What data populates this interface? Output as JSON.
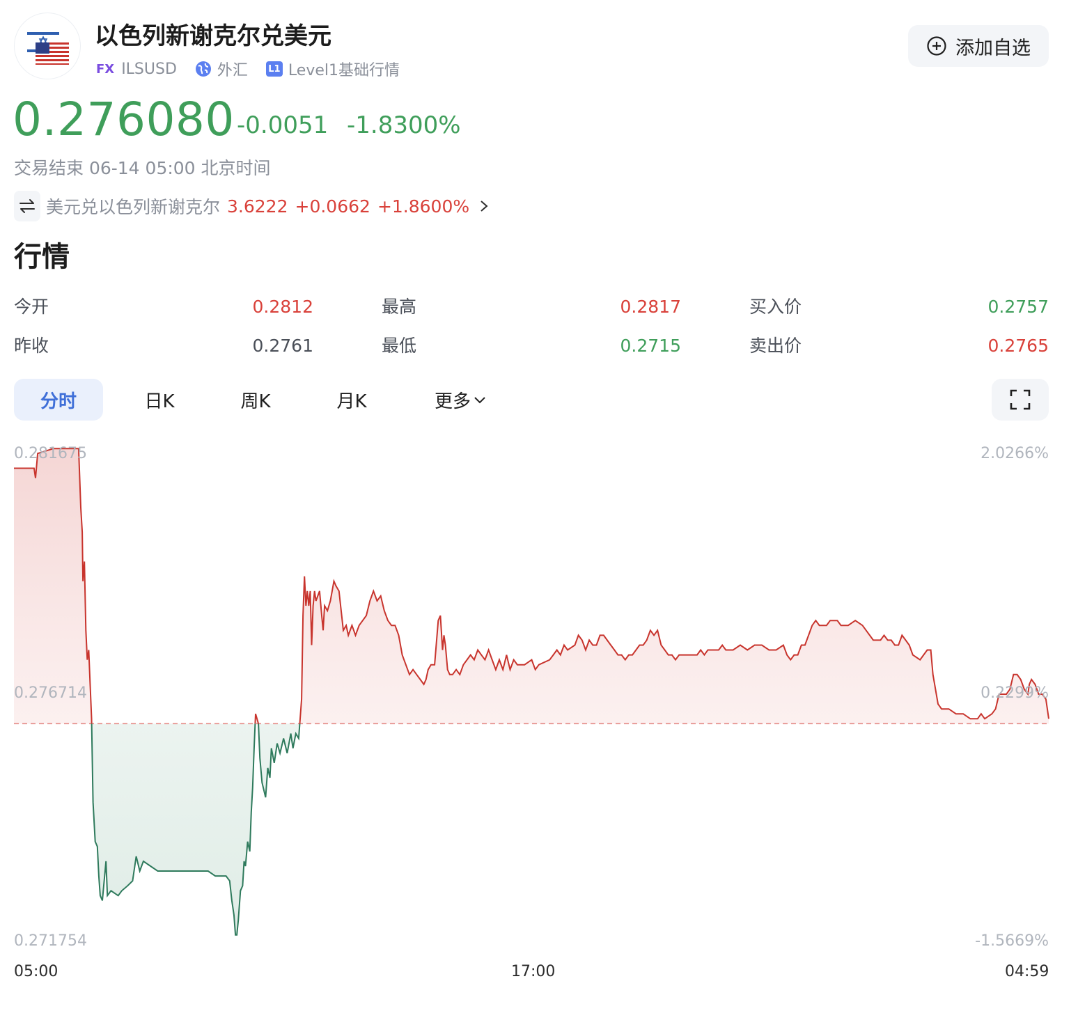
{
  "header": {
    "title": "以色列新谢克尔兑美元",
    "market_badge": "FX",
    "symbol": "ILSUSD",
    "category": "外汇",
    "level_badge": "L1",
    "level_text": "Level1基础行情",
    "add_watch_label": "添加自选"
  },
  "quote": {
    "price": "0.276080",
    "change": "-0.0051",
    "change_pct": "-1.8300%",
    "status": "交易结束 06-14 05:00 北京时间",
    "inverse_label": "美元兑以色列新谢克尔",
    "inverse_price": "3.6222",
    "inverse_change": "+0.0662",
    "inverse_change_pct": "+1.8600%"
  },
  "section_title": "行情",
  "stats": [
    {
      "label": "今开",
      "value": "0.2812",
      "color": "#d9413a"
    },
    {
      "label": "最高",
      "value": "0.2817",
      "color": "#d9413a"
    },
    {
      "label": "买入价",
      "value": "0.2757",
      "color": "#3f9e5a"
    },
    {
      "label": "昨收",
      "value": "0.2761",
      "color": "#4a4f58"
    },
    {
      "label": "最低",
      "value": "0.2715",
      "color": "#3f9e5a"
    },
    {
      "label": "卖出价",
      "value": "0.2765",
      "color": "#d9413a"
    }
  ],
  "tabs": [
    "分时",
    "日K",
    "周K",
    "月K",
    "更多"
  ],
  "colors": {
    "up": "#d9413a",
    "down": "#3f9e5a",
    "line_up": "#c8342d",
    "line_down": "#2e7a5c",
    "accent": "#3f6fd8"
  },
  "chart_data": {
    "type": "line",
    "title": "",
    "prev_close": 0.2761,
    "y_labels_left": [
      "0.281675",
      "0.276714",
      "0.271754"
    ],
    "y_labels_right": [
      "2.0266%",
      "0.2299%",
      "-1.5669%"
    ],
    "ylim": [
      0.271754,
      0.281675
    ],
    "x_labels": [
      "05:00",
      "17:00",
      "04:59"
    ],
    "x_range_minutes": [
      0,
      1439
    ],
    "points": [
      [
        0,
        0.2813
      ],
      [
        28,
        0.2813
      ],
      [
        30,
        0.2811
      ],
      [
        33,
        0.2816
      ],
      [
        55,
        0.2817
      ],
      [
        90,
        0.2817
      ],
      [
        93,
        0.2805
      ],
      [
        95,
        0.28
      ],
      [
        96,
        0.279
      ],
      [
        98,
        0.2794
      ],
      [
        100,
        0.278
      ],
      [
        102,
        0.2774
      ],
      [
        104,
        0.2776
      ],
      [
        108,
        0.2762
      ],
      [
        110,
        0.2745
      ],
      [
        113,
        0.2737
      ],
      [
        116,
        0.2736
      ],
      [
        118,
        0.273
      ],
      [
        120,
        0.2726
      ],
      [
        123,
        0.2725
      ],
      [
        128,
        0.2733
      ],
      [
        130,
        0.2726
      ],
      [
        135,
        0.2727
      ],
      [
        145,
        0.2726
      ],
      [
        150,
        0.2727
      ],
      [
        158,
        0.2728
      ],
      [
        165,
        0.2729
      ],
      [
        170,
        0.2734
      ],
      [
        175,
        0.2731
      ],
      [
        180,
        0.2733
      ],
      [
        190,
        0.2732
      ],
      [
        200,
        0.2731
      ],
      [
        210,
        0.2731
      ],
      [
        240,
        0.2731
      ],
      [
        250,
        0.2731
      ],
      [
        270,
        0.2731
      ],
      [
        280,
        0.273
      ],
      [
        295,
        0.273
      ],
      [
        300,
        0.2729
      ],
      [
        303,
        0.2725
      ],
      [
        306,
        0.2722
      ],
      [
        308,
        0.2718
      ],
      [
        310,
        0.2718
      ],
      [
        312,
        0.2721
      ],
      [
        315,
        0.2727
      ],
      [
        318,
        0.2728
      ],
      [
        320,
        0.2733
      ],
      [
        322,
        0.2732
      ],
      [
        325,
        0.2737
      ],
      [
        328,
        0.2735
      ],
      [
        330,
        0.2743
      ],
      [
        332,
        0.2748
      ],
      [
        334,
        0.2756
      ],
      [
        336,
        0.2763
      ],
      [
        340,
        0.2761
      ],
      [
        342,
        0.2754
      ],
      [
        345,
        0.2749
      ],
      [
        350,
        0.2746
      ],
      [
        353,
        0.2752
      ],
      [
        356,
        0.275
      ],
      [
        358,
        0.2756
      ],
      [
        362,
        0.2753
      ],
      [
        366,
        0.2757
      ],
      [
        370,
        0.2755
      ],
      [
        375,
        0.2758
      ],
      [
        380,
        0.2755
      ],
      [
        385,
        0.2759
      ],
      [
        388,
        0.2756
      ],
      [
        392,
        0.2759
      ],
      [
        396,
        0.2758
      ],
      [
        398,
        0.2762
      ],
      [
        400,
        0.2766
      ],
      [
        402,
        0.2783
      ],
      [
        404,
        0.2791
      ],
      [
        406,
        0.2785
      ],
      [
        408,
        0.2788
      ],
      [
        410,
        0.2785
      ],
      [
        412,
        0.2788
      ],
      [
        414,
        0.2777
      ],
      [
        416,
        0.2785
      ],
      [
        418,
        0.2788
      ],
      [
        420,
        0.2786
      ],
      [
        425,
        0.2788
      ],
      [
        428,
        0.2783
      ],
      [
        430,
        0.278
      ],
      [
        432,
        0.2785
      ],
      [
        436,
        0.2784
      ],
      [
        440,
        0.2786
      ],
      [
        445,
        0.279
      ],
      [
        448,
        0.2789
      ],
      [
        452,
        0.2788
      ],
      [
        455,
        0.2784
      ],
      [
        458,
        0.278
      ],
      [
        462,
        0.2781
      ],
      [
        465,
        0.2779
      ],
      [
        470,
        0.2781
      ],
      [
        475,
        0.2779
      ],
      [
        480,
        0.2781
      ],
      [
        490,
        0.2783
      ],
      [
        495,
        0.2786
      ],
      [
        500,
        0.2788
      ],
      [
        505,
        0.2786
      ],
      [
        510,
        0.2787
      ],
      [
        515,
        0.2784
      ],
      [
        520,
        0.2782
      ],
      [
        525,
        0.2781
      ],
      [
        530,
        0.2781
      ],
      [
        535,
        0.2779
      ],
      [
        540,
        0.2775
      ],
      [
        545,
        0.2773
      ],
      [
        550,
        0.2771
      ],
      [
        555,
        0.2772
      ],
      [
        560,
        0.2771
      ],
      [
        565,
        0.277
      ],
      [
        570,
        0.2769
      ],
      [
        573,
        0.277
      ],
      [
        576,
        0.2772
      ],
      [
        580,
        0.2773
      ],
      [
        585,
        0.2773
      ],
      [
        590,
        0.2782
      ],
      [
        593,
        0.2783
      ],
      [
        596,
        0.2776
      ],
      [
        598,
        0.2779
      ],
      [
        600,
        0.2777
      ],
      [
        603,
        0.2772
      ],
      [
        606,
        0.2771
      ],
      [
        610,
        0.2771
      ],
      [
        615,
        0.2772
      ],
      [
        620,
        0.2771
      ],
      [
        625,
        0.2773
      ],
      [
        630,
        0.2774
      ],
      [
        635,
        0.2775
      ],
      [
        640,
        0.2774
      ],
      [
        645,
        0.2776
      ],
      [
        650,
        0.2775
      ],
      [
        655,
        0.2774
      ],
      [
        660,
        0.2776
      ],
      [
        665,
        0.2774
      ],
      [
        670,
        0.2772
      ],
      [
        675,
        0.2774
      ],
      [
        680,
        0.2772
      ],
      [
        685,
        0.2775
      ],
      [
        690,
        0.2772
      ],
      [
        695,
        0.2774
      ],
      [
        700,
        0.2773
      ],
      [
        710,
        0.2773
      ],
      [
        720,
        0.2774
      ],
      [
        725,
        0.2772
      ],
      [
        730,
        0.2773
      ],
      [
        745,
        0.2774
      ],
      [
        750,
        0.2775
      ],
      [
        755,
        0.2776
      ],
      [
        760,
        0.2775
      ],
      [
        765,
        0.2777
      ],
      [
        770,
        0.2776
      ],
      [
        780,
        0.2777
      ],
      [
        785,
        0.2779
      ],
      [
        790,
        0.2778
      ],
      [
        795,
        0.2776
      ],
      [
        800,
        0.2778
      ],
      [
        805,
        0.2777
      ],
      [
        810,
        0.2777
      ],
      [
        815,
        0.2779
      ],
      [
        820,
        0.2779
      ],
      [
        825,
        0.2778
      ],
      [
        830,
        0.2777
      ],
      [
        835,
        0.2776
      ],
      [
        840,
        0.2775
      ],
      [
        845,
        0.2775
      ],
      [
        850,
        0.2774
      ],
      [
        855,
        0.2775
      ],
      [
        860,
        0.2775
      ],
      [
        865,
        0.2776
      ],
      [
        870,
        0.2777
      ],
      [
        875,
        0.2777
      ],
      [
        880,
        0.2778
      ],
      [
        885,
        0.278
      ],
      [
        890,
        0.2779
      ],
      [
        895,
        0.278
      ],
      [
        900,
        0.2777
      ],
      [
        905,
        0.2776
      ],
      [
        910,
        0.2775
      ],
      [
        915,
        0.2775
      ],
      [
        920,
        0.2774
      ],
      [
        925,
        0.2775
      ],
      [
        930,
        0.2775
      ],
      [
        940,
        0.2775
      ],
      [
        950,
        0.2775
      ],
      [
        955,
        0.2776
      ],
      [
        960,
        0.2775
      ],
      [
        965,
        0.2776
      ],
      [
        970,
        0.2776
      ],
      [
        980,
        0.2776
      ],
      [
        985,
        0.2777
      ],
      [
        990,
        0.2776
      ],
      [
        1000,
        0.2776
      ],
      [
        1010,
        0.2777
      ],
      [
        1020,
        0.2776
      ],
      [
        1030,
        0.2777
      ],
      [
        1040,
        0.2777
      ],
      [
        1050,
        0.2776
      ],
      [
        1060,
        0.2776
      ],
      [
        1070,
        0.2777
      ],
      [
        1075,
        0.2775
      ],
      [
        1080,
        0.2774
      ],
      [
        1085,
        0.2775
      ],
      [
        1090,
        0.2775
      ],
      [
        1095,
        0.2777
      ],
      [
        1100,
        0.2777
      ],
      [
        1105,
        0.2779
      ],
      [
        1110,
        0.2781
      ],
      [
        1115,
        0.2782
      ],
      [
        1120,
        0.2781
      ],
      [
        1125,
        0.2781
      ],
      [
        1130,
        0.2781
      ],
      [
        1135,
        0.2782
      ],
      [
        1140,
        0.2782
      ],
      [
        1145,
        0.2782
      ],
      [
        1150,
        0.2781
      ],
      [
        1160,
        0.2781
      ],
      [
        1170,
        0.2782
      ],
      [
        1180,
        0.2781
      ],
      [
        1185,
        0.278
      ],
      [
        1190,
        0.2779
      ],
      [
        1195,
        0.2778
      ],
      [
        1200,
        0.2778
      ],
      [
        1205,
        0.2778
      ],
      [
        1210,
        0.2779
      ],
      [
        1215,
        0.2778
      ],
      [
        1220,
        0.2778
      ],
      [
        1225,
        0.2777
      ],
      [
        1230,
        0.2777
      ],
      [
        1235,
        0.2779
      ],
      [
        1240,
        0.2778
      ],
      [
        1245,
        0.2777
      ],
      [
        1250,
        0.2775
      ],
      [
        1260,
        0.2774
      ],
      [
        1265,
        0.2775
      ],
      [
        1270,
        0.2776
      ],
      [
        1275,
        0.2776
      ],
      [
        1278,
        0.2771
      ],
      [
        1285,
        0.2765
      ],
      [
        1290,
        0.2764
      ],
      [
        1300,
        0.2764
      ],
      [
        1310,
        0.2763
      ],
      [
        1320,
        0.2763
      ],
      [
        1330,
        0.2762
      ],
      [
        1340,
        0.2762
      ],
      [
        1345,
        0.2763
      ],
      [
        1350,
        0.2762
      ],
      [
        1360,
        0.2763
      ],
      [
        1365,
        0.2764
      ],
      [
        1370,
        0.2767
      ],
      [
        1375,
        0.2767
      ],
      [
        1380,
        0.2767
      ],
      [
        1385,
        0.2768
      ],
      [
        1390,
        0.2771
      ],
      [
        1395,
        0.2771
      ],
      [
        1400,
        0.277
      ],
      [
        1405,
        0.2768
      ],
      [
        1410,
        0.2767
      ],
      [
        1412,
        0.2769
      ],
      [
        1415,
        0.277
      ],
      [
        1420,
        0.2769
      ],
      [
        1425,
        0.2767
      ],
      [
        1430,
        0.2767
      ],
      [
        1435,
        0.2766
      ],
      [
        1439,
        0.2762
      ]
    ]
  }
}
